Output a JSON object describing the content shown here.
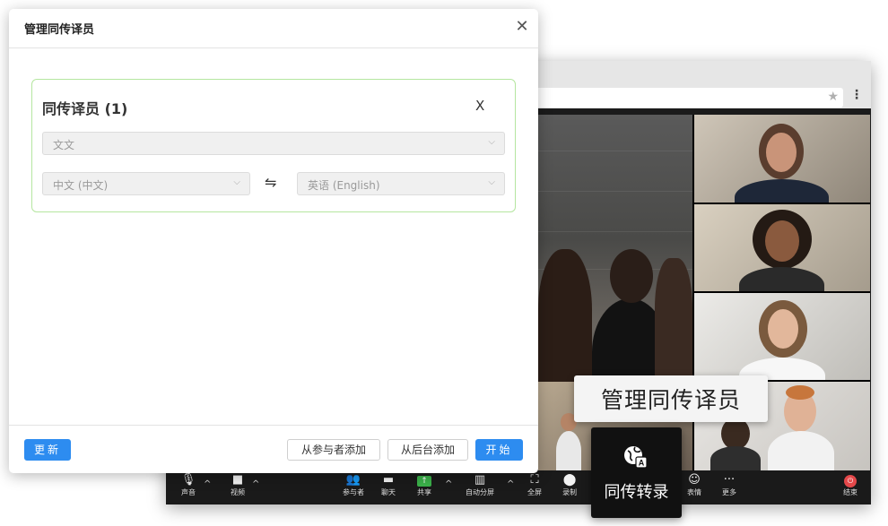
{
  "dialog": {
    "title": "管理同传译员",
    "close_glyph": "✕",
    "card": {
      "title": "同传译员 (1)",
      "remove_glyph": "X",
      "interpreter_placeholder": "文文",
      "source_language": "中文 (中文)",
      "swap_glyph": "⇋",
      "target_language": "英语 (English)"
    },
    "footer": {
      "update_label": "更新",
      "add_from_participants_label": "从参与者添加",
      "add_from_backend_label": "从后台添加",
      "start_label": "开始"
    },
    "colors": {
      "primary": "#2d8cf0",
      "card_border": "#b5e6a0"
    }
  },
  "browser": {
    "star_glyph": "★",
    "menu_glyph": "⋮"
  },
  "toolbar": {
    "items": [
      {
        "label": "声音",
        "icon": "microphone-icon",
        "glyph": "🎙"
      },
      {
        "label": "视频",
        "icon": "video-camera-icon",
        "glyph": "■"
      },
      {
        "label": "参与者",
        "icon": "participants-icon",
        "glyph": "👥"
      },
      {
        "label": "聊天",
        "icon": "chat-icon",
        "glyph": "▬"
      },
      {
        "label": "共享",
        "icon": "share-screen-icon",
        "glyph": "↑"
      },
      {
        "label": "自动分屏",
        "icon": "split-screen-icon",
        "glyph": "▥"
      },
      {
        "label": "全屏",
        "icon": "fullscreen-icon",
        "glyph": "⛶"
      },
      {
        "label": "录制",
        "icon": "record-icon",
        "glyph": "⬤"
      },
      {
        "label": "表情",
        "icon": "emoji-icon",
        "glyph": "☺"
      },
      {
        "label": "更多",
        "icon": "more-icon",
        "glyph": "···"
      },
      {
        "label": "结束",
        "icon": "end-meeting-icon",
        "glyph": "⏻"
      }
    ],
    "caret_glyph": "^",
    "colors": {
      "share": "#3bb14a",
      "end": "#e4484a"
    }
  },
  "callouts": {
    "manage_interpreters": "管理同传译员",
    "interpretation": "同传转录",
    "interpretation_icon": "globe-translate-icon"
  }
}
